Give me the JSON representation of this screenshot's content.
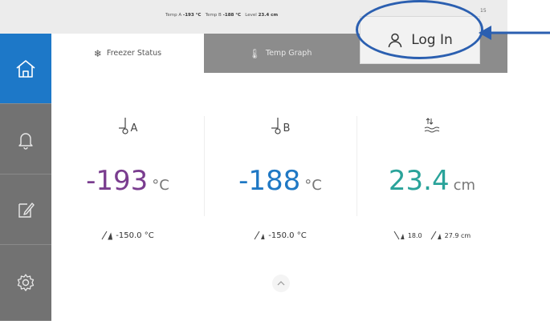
{
  "topbar": {
    "temp_a_label": "Temp A",
    "temp_a_value": "-193 °C",
    "temp_b_label": "Temp B",
    "temp_b_value": "-188 °C",
    "level_label": "Level",
    "level_value": "23.4 cm",
    "time": "15",
    "time_sub": "15"
  },
  "login": {
    "label": "Log In",
    "icon": "user-icon"
  },
  "sidebar": [
    {
      "icon": "home-icon",
      "active": true
    },
    {
      "icon": "bell-icon",
      "active": false
    },
    {
      "icon": "notes-icon",
      "active": false
    },
    {
      "icon": "gear-icon",
      "active": false
    }
  ],
  "tabs": [
    {
      "label": "Freezer Status",
      "icon": "snowflake-icon",
      "active": true
    },
    {
      "label": "Temp Graph",
      "icon": "thermometer-icon",
      "active": false
    },
    {
      "label": "",
      "active": false
    }
  ],
  "readouts": {
    "a": {
      "sensor_label": "A",
      "value": "-193",
      "unit": "°C",
      "color": "#7a3d8f",
      "alarm": "-150.0 °C"
    },
    "b": {
      "sensor_label": "B",
      "value": "-188",
      "unit": "°C",
      "color": "#1f78c4",
      "alarm": "-150.0 °C"
    },
    "level": {
      "value": "23.4",
      "unit": "cm",
      "color": "#2aa39a",
      "low_alarm": "18.0",
      "high_alarm": "27.9 cm"
    }
  },
  "colors": {
    "accent": "#1d78c8",
    "highlight": "#2b5fb0",
    "sidebar": "#727272"
  }
}
